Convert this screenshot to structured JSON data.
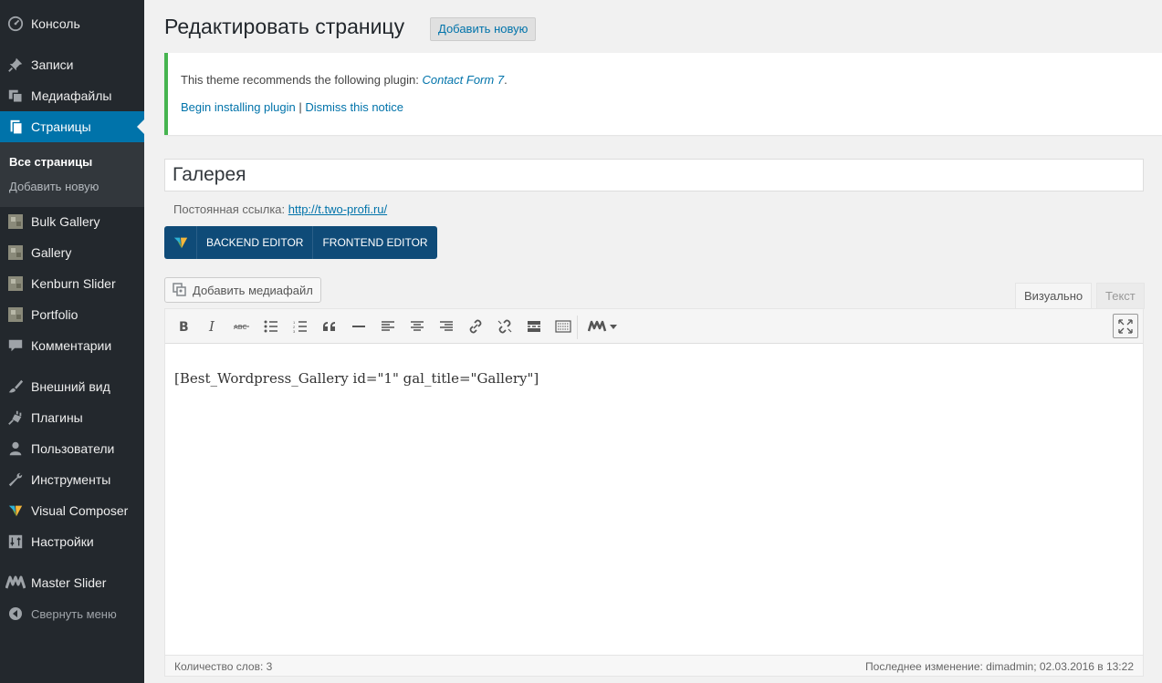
{
  "sidebar": {
    "items": [
      {
        "label": "Консоль",
        "icon": "dashboard-icon"
      },
      {
        "label": "Записи",
        "icon": "pin-icon"
      },
      {
        "label": "Медиафайлы",
        "icon": "media-icon"
      },
      {
        "label": "Страницы",
        "icon": "pages-icon"
      },
      {
        "label": "Bulk Gallery",
        "icon": "gallery-icon"
      },
      {
        "label": "Gallery",
        "icon": "gallery-icon"
      },
      {
        "label": "Kenburn Slider",
        "icon": "gallery-icon"
      },
      {
        "label": "Portfolio",
        "icon": "gallery-icon"
      },
      {
        "label": "Комментарии",
        "icon": "comment-icon"
      },
      {
        "label": "Внешний вид",
        "icon": "brush-icon"
      },
      {
        "label": "Плагины",
        "icon": "plugin-icon"
      },
      {
        "label": "Пользователи",
        "icon": "user-icon"
      },
      {
        "label": "Инструменты",
        "icon": "wrench-icon"
      },
      {
        "label": "Visual Composer",
        "icon": "vc-icon"
      },
      {
        "label": "Настройки",
        "icon": "settings-icon"
      },
      {
        "label": "Master Slider",
        "icon": "master-slider-icon"
      }
    ],
    "submenu": {
      "all_pages": "Все страницы",
      "add_new": "Добавить новую"
    },
    "collapse_label": "Свернуть меню"
  },
  "header": {
    "title": "Редактировать страницу",
    "add_new_label": "Добавить новую"
  },
  "notice": {
    "text_prefix": "This theme recommends the following plugin: ",
    "plugin_name": "Contact Form 7",
    "text_suffix": ".",
    "install_link": "Begin installing plugin",
    "separator": " | ",
    "dismiss_link": "Dismiss this notice",
    "accent_color": "#46b450"
  },
  "post": {
    "title": "Галерея",
    "permalink_label": "Постоянная ссылка: ",
    "permalink_url": "http://t.two-profi.ru/"
  },
  "vc": {
    "backend_label": "BACKEND EDITOR",
    "frontend_label": "FRONTEND EDITOR",
    "bar_color": "#0f4b78"
  },
  "editor": {
    "add_media_label": "Добавить медиафайл",
    "tab_visual": "Визуально",
    "tab_text": "Текст",
    "content": "[Best_Wordpress_Gallery id=\"1\" gal_title=\"Gallery\"]",
    "word_count": "Количество слов: 3",
    "last_edit": "Последнее изменение: dimadmin; 02.03.2016 в 13:22"
  }
}
